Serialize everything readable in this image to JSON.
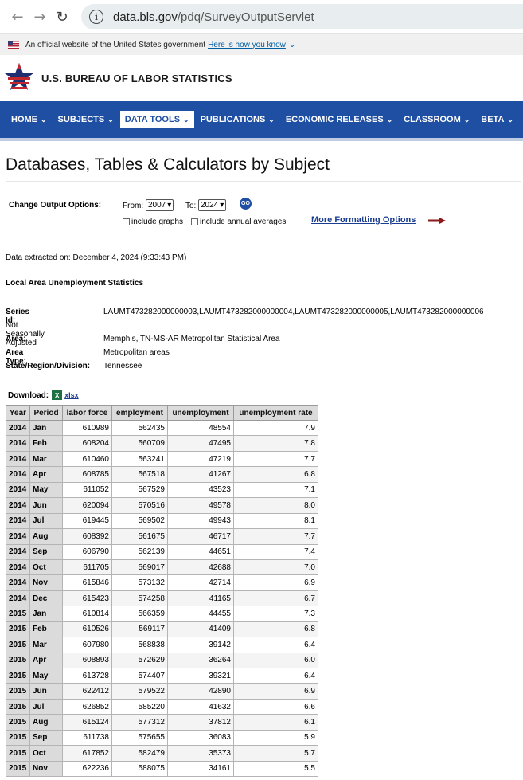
{
  "browser": {
    "url_host": "data.bls.gov",
    "url_path": "/pdq/SurveyOutputServlet"
  },
  "gov_banner": {
    "text": "An official website of the United States government",
    "link": "Here is how you know"
  },
  "header": {
    "title": "U.S. BUREAU OF LABOR STATISTICS"
  },
  "nav": {
    "items": [
      {
        "label": "HOME"
      },
      {
        "label": "SUBJECTS"
      },
      {
        "label": "DATA TOOLS"
      },
      {
        "label": "PUBLICATIONS"
      },
      {
        "label": "ECONOMIC RELEASES"
      },
      {
        "label": "CLASSROOM"
      },
      {
        "label": "BETA"
      }
    ],
    "active_index": 2
  },
  "page": {
    "title": "Databases, Tables & Calculators by Subject"
  },
  "options": {
    "label": "Change Output Options:",
    "from_label": "From:",
    "from_value": "2007",
    "to_label": "To:",
    "to_value": "2024",
    "go_label": "GO",
    "graphs_label": "include graphs",
    "annual_label": "include annual averages",
    "more_label": "More Formatting Options"
  },
  "meta": {
    "extracted": "Data extracted on: December 4, 2024 (9:33:43 PM)",
    "survey": "Local Area Unemployment Statistics",
    "series_label": "Series Id:",
    "series_value": "LAUMT473282000000003,LAUMT473282000000004,LAUMT473282000000005,LAUMT473282000000006",
    "seasonal": "Not Seasonally Adjusted",
    "area_label": "Area:",
    "area_value": "Memphis, TN-MS-AR Metropolitan Statistical Area",
    "area_type_label": "Area Type:",
    "area_type_value": "Metropolitan areas",
    "state_label": "State/Region/Division:",
    "state_value": "Tennessee"
  },
  "download": {
    "label": "Download:",
    "icon_text": "X",
    "link": "xlsx"
  },
  "table": {
    "headers": [
      "Year",
      "Period",
      "labor force",
      "employment",
      "unemployment",
      "unemployment rate"
    ],
    "rows": [
      [
        "2014",
        "Jan",
        "610989",
        "562435",
        "48554",
        "7.9"
      ],
      [
        "2014",
        "Feb",
        "608204",
        "560709",
        "47495",
        "7.8"
      ],
      [
        "2014",
        "Mar",
        "610460",
        "563241",
        "47219",
        "7.7"
      ],
      [
        "2014",
        "Apr",
        "608785",
        "567518",
        "41267",
        "6.8"
      ],
      [
        "2014",
        "May",
        "611052",
        "567529",
        "43523",
        "7.1"
      ],
      [
        "2014",
        "Jun",
        "620094",
        "570516",
        "49578",
        "8.0"
      ],
      [
        "2014",
        "Jul",
        "619445",
        "569502",
        "49943",
        "8.1"
      ],
      [
        "2014",
        "Aug",
        "608392",
        "561675",
        "46717",
        "7.7"
      ],
      [
        "2014",
        "Sep",
        "606790",
        "562139",
        "44651",
        "7.4"
      ],
      [
        "2014",
        "Oct",
        "611705",
        "569017",
        "42688",
        "7.0"
      ],
      [
        "2014",
        "Nov",
        "615846",
        "573132",
        "42714",
        "6.9"
      ],
      [
        "2014",
        "Dec",
        "615423",
        "574258",
        "41165",
        "6.7"
      ],
      [
        "2015",
        "Jan",
        "610814",
        "566359",
        "44455",
        "7.3"
      ],
      [
        "2015",
        "Feb",
        "610526",
        "569117",
        "41409",
        "6.8"
      ],
      [
        "2015",
        "Mar",
        "607980",
        "568838",
        "39142",
        "6.4"
      ],
      [
        "2015",
        "Apr",
        "608893",
        "572629",
        "36264",
        "6.0"
      ],
      [
        "2015",
        "May",
        "613728",
        "574407",
        "39321",
        "6.4"
      ],
      [
        "2015",
        "Jun",
        "622412",
        "579522",
        "42890",
        "6.9"
      ],
      [
        "2015",
        "Jul",
        "626852",
        "585220",
        "41632",
        "6.6"
      ],
      [
        "2015",
        "Aug",
        "615124",
        "577312",
        "37812",
        "6.1"
      ],
      [
        "2015",
        "Sep",
        "611738",
        "575655",
        "36083",
        "5.9"
      ],
      [
        "2015",
        "Oct",
        "617852",
        "582479",
        "35373",
        "5.7"
      ],
      [
        "2015",
        "Nov",
        "622236",
        "588075",
        "34161",
        "5.5"
      ]
    ]
  },
  "colors": {
    "nav_bg": "#1f4fa3",
    "link": "#1a3d8f",
    "table_header": "#dbdbdb",
    "arrow": "#8b1a1a"
  }
}
